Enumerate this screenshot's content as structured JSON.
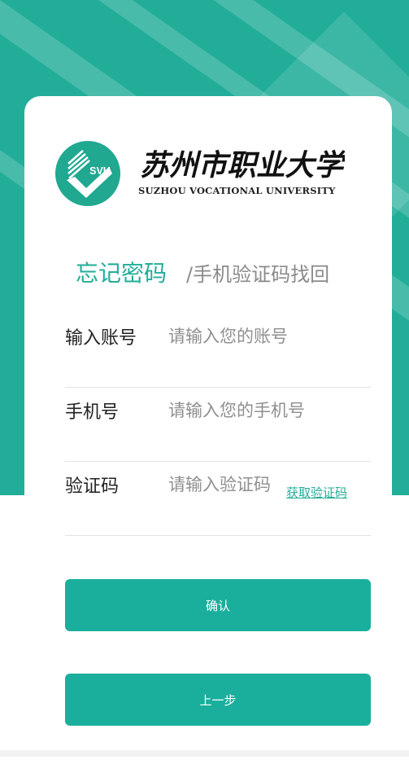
{
  "colors": {
    "accent": "#22ad99",
    "button": "#1aaf9c",
    "background": "#22ad99"
  },
  "logo": {
    "emblem_text": "SVU",
    "name_cn": "苏州市职业大学",
    "name_en": "SUZHOU VOCATIONAL UNIVERSITY"
  },
  "title": {
    "main": "忘记密码",
    "sub": "/手机验证码找回"
  },
  "form": {
    "account": {
      "label": "输入账号",
      "placeholder": "请输入您的账号",
      "value": ""
    },
    "phone": {
      "label": "手机号",
      "placeholder": "请输入您的手机号",
      "value": ""
    },
    "code": {
      "label": "验证码",
      "placeholder": "请输入验证码",
      "value": "",
      "get_code_label": "获取验证码"
    }
  },
  "buttons": {
    "confirm": "确认",
    "previous": "上一步"
  }
}
